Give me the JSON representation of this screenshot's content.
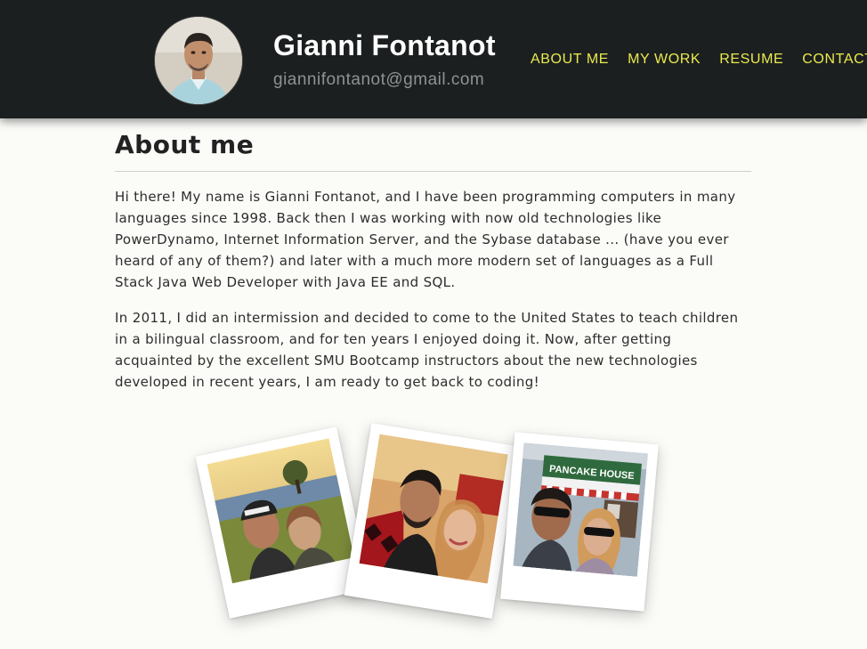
{
  "header": {
    "name": "Gianni Fontanot",
    "email": "giannifontanot@gmail.com",
    "nav": [
      {
        "label": "ABOUT ME"
      },
      {
        "label": "MY WORK"
      },
      {
        "label": "RESUME"
      },
      {
        "label": "CONTACT"
      }
    ]
  },
  "about": {
    "title": "About me",
    "paragraph1": "Hi there! My name is Gianni Fontanot, and I have been programming computers in many languages since 1998. Back then I was working with now old technologies like PowerDynamo, Internet Information Server, and the Sybase database ... (have you ever heard of any of them?) and later with a much more modern set of languages as a Full Stack Java Web Developer with Java EE and SQL.",
    "paragraph2": "In 2011, I did an intermission and decided to come to the United States to teach children in a bilingual classroom, and for ten years I enjoyed doing it. Now, after getting acquainted by the excellent SMU Bootcamp instructors about the new technologies developed in recent years, I am ready to get back to coding!"
  },
  "gallery": {
    "photo3_sign": "PANCAKE HOUSE"
  }
}
